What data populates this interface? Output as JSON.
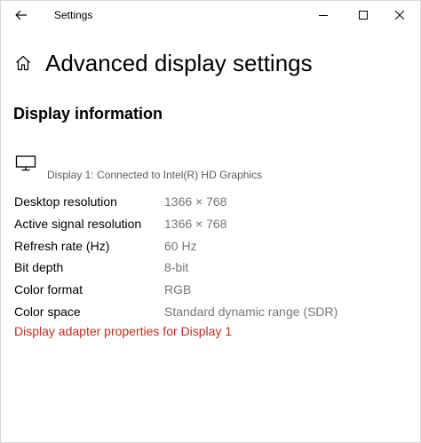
{
  "window": {
    "app_title": "Settings"
  },
  "header": {
    "title": "Advanced display settings"
  },
  "section": {
    "title": "Display information"
  },
  "display": {
    "description": "Display 1: Connected to Intel(R) HD Graphics"
  },
  "info": {
    "rows": [
      {
        "label": "Desktop resolution",
        "value": "1366 × 768"
      },
      {
        "label": "Active signal resolution",
        "value": "1366 × 768"
      },
      {
        "label": "Refresh rate (Hz)",
        "value": "60 Hz"
      },
      {
        "label": "Bit depth",
        "value": "8-bit"
      },
      {
        "label": "Color format",
        "value": "RGB"
      },
      {
        "label": "Color space",
        "value": "Standard dynamic range (SDR)"
      }
    ]
  },
  "links": {
    "adapter_properties": "Display adapter properties for Display 1"
  },
  "colors": {
    "link": "#c42b1c",
    "value_text": "#767676",
    "secondary_text": "#5a5a5a"
  },
  "icons": {
    "back": "back-arrow-icon",
    "minimize": "minimize-icon",
    "maximize": "maximize-icon",
    "close": "close-icon",
    "home": "home-icon",
    "monitor": "monitor-icon"
  }
}
